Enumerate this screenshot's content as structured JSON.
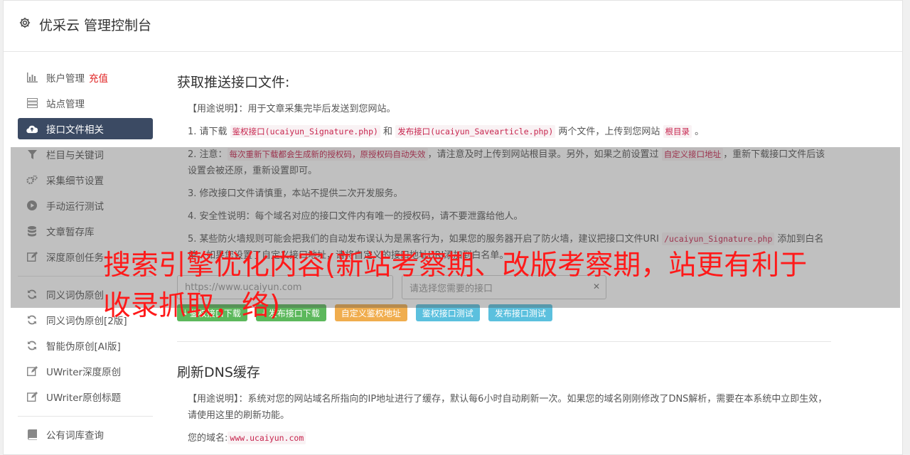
{
  "header": {
    "title": "优采云 管理控制台"
  },
  "sidebar": {
    "items": [
      {
        "label": "账户管理",
        "extra": "充值",
        "icon": "bar-chart-icon"
      },
      {
        "label": "站点管理",
        "icon": "server-icon"
      },
      {
        "label": "接口文件相关",
        "icon": "cloud-upload-icon"
      },
      {
        "label": "栏目与关键词",
        "icon": "filter-icon"
      },
      {
        "label": "采集细节设置",
        "icon": "cogs-icon"
      },
      {
        "label": "手动运行测试",
        "icon": "play-circle-icon"
      },
      {
        "label": "文章暂存库",
        "icon": "database-icon"
      },
      {
        "label": "深度原创任务",
        "icon": "edit-icon"
      },
      {
        "label": "同义词伪原创",
        "icon": "refresh-icon"
      },
      {
        "label": "同义词伪原创[2版]",
        "icon": "refresh-icon"
      },
      {
        "label": "智能伪原创[AI版]",
        "icon": "refresh-icon"
      },
      {
        "label": "UWriter深度原创",
        "icon": "edit-icon"
      },
      {
        "label": "UWriter原创标题",
        "icon": "edit-icon"
      },
      {
        "label": "公有词库查询",
        "icon": "book-icon"
      }
    ]
  },
  "section1": {
    "title": "获取推送接口文件:",
    "p0": "【用途说明】：用于文章采集完毕后发送到您网站。",
    "p1": {
      "a": "1. 请下载 ",
      "c1": "鉴权接口(ucaiyun_Signature.php)",
      "b": " 和 ",
      "c2": "发布接口(ucaiyun_Savearticle.php)",
      "d": " 两个文件，上传到您网站 ",
      "c3": "根目录",
      "e": " 。"
    },
    "p2": {
      "a": "2. 注意：",
      "c1": "每次重新下载都会生成新的授权码，原授权码自动失效",
      "b": "，请注意及时上传到网站根目录。另外，如果之前设置过 ",
      "c2": "自定义接口地址",
      "d": "，重新下载接口文件后该设置会被还原，重新设置即可。"
    },
    "p3": "3. 修改接口文件请慎重，本站不提供二次开发服务。",
    "p4": "4. 安全性说明：每个域名对应的接口文件内有唯一的授权码，请不要泄露给他人。",
    "p5": {
      "a": "5. 某些防火墙规则可能会把我们的自动发布误认为是黑客行为，如果您的服务器开启了防火墙，建议把接口文件URI ",
      "c1": "/ucaiyun_Signature.php",
      "b": " 添加到白名单。如果您设置了自定义接口地址，请将自定义的接口地址URI添加到白名单。"
    },
    "url_placeholder": "https://www.ucaiyun.com",
    "select_placeholder": "请选择您需要的接口",
    "buttons": [
      "鉴权接口下载",
      "发布接口下载",
      "自定义鉴权地址",
      "鉴权接口测试",
      "发布接口测试"
    ]
  },
  "section2": {
    "title": "刷新DNS缓存",
    "p0": "【用途说明】：系统对您的网站域名所指向的IP地址进行了缓存，默认每6小时自动刷新一次。如果您的域名刚刚修改了DNS解析，需要在本系统中立即生效，请使用这里的刷新功能。",
    "domain_label": "您的域名:",
    "domain_value": "www.ucaiyun.com"
  },
  "ad_text": "搜索引擎优化内容(新站考察期、改版考察期，站更有利于收录抓取，络)"
}
